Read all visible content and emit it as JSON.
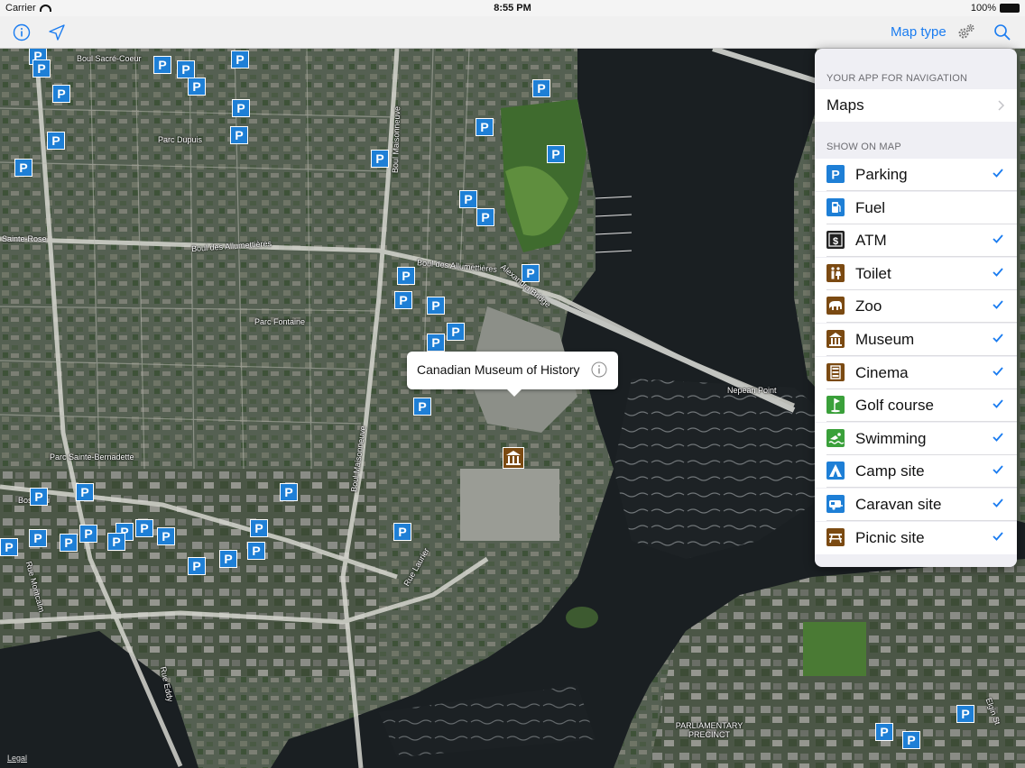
{
  "status_bar": {
    "carrier": "Carrier",
    "time": "8:55 PM",
    "battery": "100%"
  },
  "toolbar": {
    "map_type_label": "Map type"
  },
  "map": {
    "callout_title": "Canadian Museum of History",
    "legal": "Legal",
    "street_labels": [
      "Boul Sacré-Coeur",
      "Parc Dupuis",
      "Boul des Allumettières",
      "Boul des Allumettières",
      "Alexandra Bridge",
      "Parc Fontaine",
      "Boul Maisonneuve",
      "Boul Maisonneuve",
      "Parc Sainte-Bernadette",
      "Rue Montcalm",
      "Rue Eddy",
      "Rue Laurier",
      "Nepean Point",
      "PARLIAMENTARY PRECINCT",
      "Elgin St",
      "Sainte-Rose",
      "Bosseau"
    ]
  },
  "popover": {
    "nav_header": "YOUR APP FOR NAVIGATION",
    "nav_app": "Maps",
    "show_header": "SHOW ON MAP",
    "items": [
      {
        "label": "Parking",
        "icon": "parking-icon",
        "checked": true,
        "color": "#1e7fd6"
      },
      {
        "label": "Fuel",
        "icon": "fuel-icon",
        "checked": false,
        "color": "#1e7fd6"
      },
      {
        "label": "ATM",
        "icon": "atm-icon",
        "checked": true,
        "color": "#222222"
      },
      {
        "label": "Toilet",
        "icon": "toilet-icon",
        "checked": true,
        "color": "#7b4a12"
      },
      {
        "label": "Zoo",
        "icon": "zoo-icon",
        "checked": true,
        "color": "#7b4a12"
      },
      {
        "label": "Museum",
        "icon": "museum-icon",
        "checked": true,
        "color": "#7b4a12"
      },
      {
        "label": "Cinema",
        "icon": "cinema-icon",
        "checked": true,
        "color": "#7b4a12"
      },
      {
        "label": "Golf course",
        "icon": "golf-icon",
        "checked": true,
        "color": "#3aa03a"
      },
      {
        "label": "Swimming",
        "icon": "swimming-icon",
        "checked": true,
        "color": "#3aa03a"
      },
      {
        "label": "Camp site",
        "icon": "camp-icon",
        "checked": true,
        "color": "#1e7fd6"
      },
      {
        "label": "Caravan site",
        "icon": "caravan-icon",
        "checked": true,
        "color": "#1e7fd6"
      },
      {
        "label": "Picnic site",
        "icon": "picnic-icon",
        "checked": true,
        "color": "#7b4a12"
      }
    ]
  }
}
